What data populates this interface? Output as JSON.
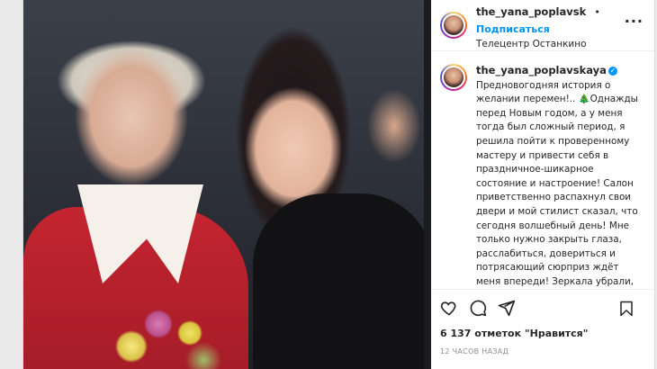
{
  "post": {
    "username": "the_yana_poplavsk",
    "follow_label": "Подписаться",
    "location": "Телецентр Останкино",
    "more_icon": "more-dots-icon"
  },
  "caption": {
    "username": "the_yana_poplavskaya",
    "verified": true,
    "text": "Предновогодняя история о желании перемен!.. 🎄Однажды перед Новым годом, а у меня тогда был сложный период, я решила пойти к проверенному мастеру и привести себя в праздничное-шикарное состояние и настроение! Салон приветственно распахнул свои двери и мой стилист сказал, что сегодня волшебный день! Мне только нужно закрыть глаза, расслабиться, довериться и потрясающий сюрприз ждёт меня впереди! Зеркала убрали, но меня это не насторожило...\n\nЭффект от сюрприза превзошёл все мыслимые и немыслимые ожидания, я"
  },
  "actions": {
    "like_icon": "heart-icon",
    "comment_icon": "comment-icon",
    "share_icon": "share-icon",
    "save_icon": "bookmark-icon"
  },
  "likes_text": "6 137 отметок \"Нравится\"",
  "timestamp": "12 ЧАСОВ НАЗАД",
  "colors": {
    "link": "#0095f6",
    "text": "#262626",
    "muted": "#8e8e8e"
  }
}
